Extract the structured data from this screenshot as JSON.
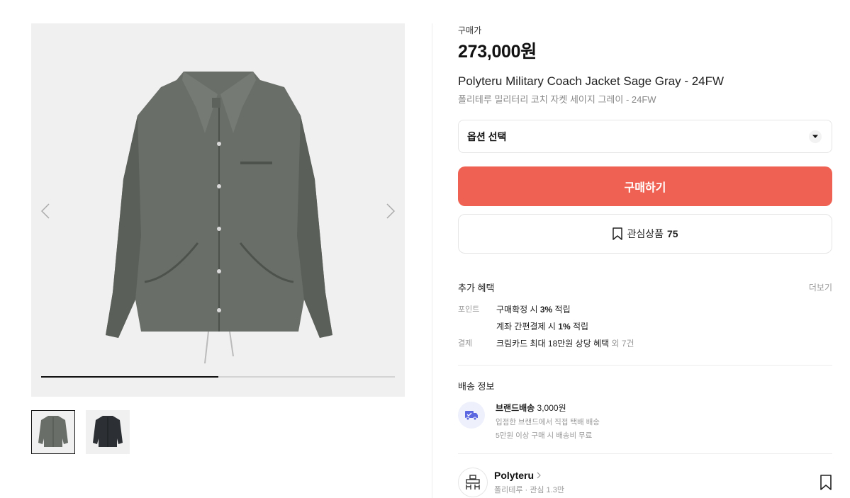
{
  "gallery": {
    "progress": 0.5,
    "thumbnails": [
      "sage-gray-jacket",
      "black-jacket"
    ]
  },
  "product": {
    "price_label": "구매가",
    "price": "273,000원",
    "title_en": "Polyteru Military Coach Jacket Sage Gray - 24FW",
    "title_ko": "폴리테루 밀리터리 코치 자켓 세이지 그레이 - 24FW"
  },
  "option": {
    "label": "옵션 선택"
  },
  "buy_button": {
    "label": "구매하기",
    "color": "#ef6253"
  },
  "wishlist": {
    "label": "관심상품",
    "count": "75"
  },
  "benefits": {
    "title": "추가 혜택",
    "more": "더보기",
    "point_key": "포인트",
    "point_1_a": "구매확정 시 ",
    "point_1_b": "3%",
    "point_1_c": " 적립",
    "point_2_a": "계좌 간편결제 시 ",
    "point_2_b": "1%",
    "point_2_c": " 적립",
    "pay_key": "결제",
    "pay_a": "크림카드 최대 18만원 상당 혜택",
    "pay_b": " 외 7건"
  },
  "shipping": {
    "title": "배송 정보",
    "name": "브랜드배송",
    "fee": " 3,000원",
    "line2": "입점한 브랜드에서 직접 택배 배송",
    "line3": "5만원 이상 구매 시 배송비 무료"
  },
  "brand": {
    "name": "Polyteru",
    "sub": "폴리테루 · 관심 1.3만"
  }
}
